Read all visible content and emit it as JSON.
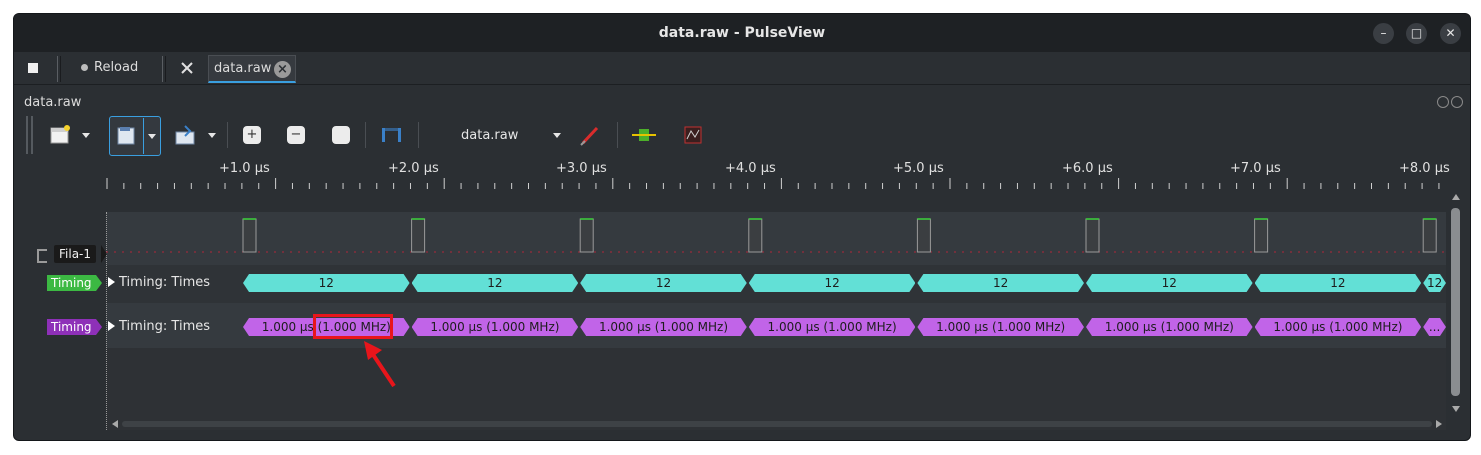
{
  "window": {
    "title": "data.raw - PulseView",
    "controls": [
      "–",
      "□",
      "✕"
    ]
  },
  "tabbar": {
    "reload_label": "Reload",
    "session_tab": "data.raw"
  },
  "panel": {
    "title": "data.raw"
  },
  "toolbar": {
    "device_select": "data.raw"
  },
  "ruler": {
    "labels": [
      "+1.0 µs",
      "+2.0 µs",
      "+3.0 µs",
      "+4.0 µs",
      "+5.0 µs",
      "+6.0 µs",
      "+7.0 µs",
      "+8.0 µs"
    ]
  },
  "signals": {
    "logic": {
      "name": "Fila-1"
    },
    "decoder1": {
      "badge": "Timing",
      "row_label": "Timing: Times",
      "badge_color": "#3cb943",
      "segment_color": "#62e0d6",
      "values": [
        "12",
        "12",
        "12",
        "12",
        "12",
        "12",
        "12",
        "12"
      ]
    },
    "decoder2": {
      "badge": "Timing",
      "row_label": "Timing: Times",
      "badge_color": "#8e30b8",
      "segment_color": "#c164e8",
      "values": [
        "1.000 µs (1.000 MHz)",
        "1.000 µs (1.000 MHz)",
        "1.000 µs (1.000 MHz)",
        "1.000 µs (1.000 MHz)",
        "1.000 µs (1.000 MHz)",
        "1.000 µs (1.000 MHz)",
        "1.000 µs (1.000 MHz)",
        "..."
      ]
    }
  },
  "annotation": {
    "color": "#e8151b"
  }
}
